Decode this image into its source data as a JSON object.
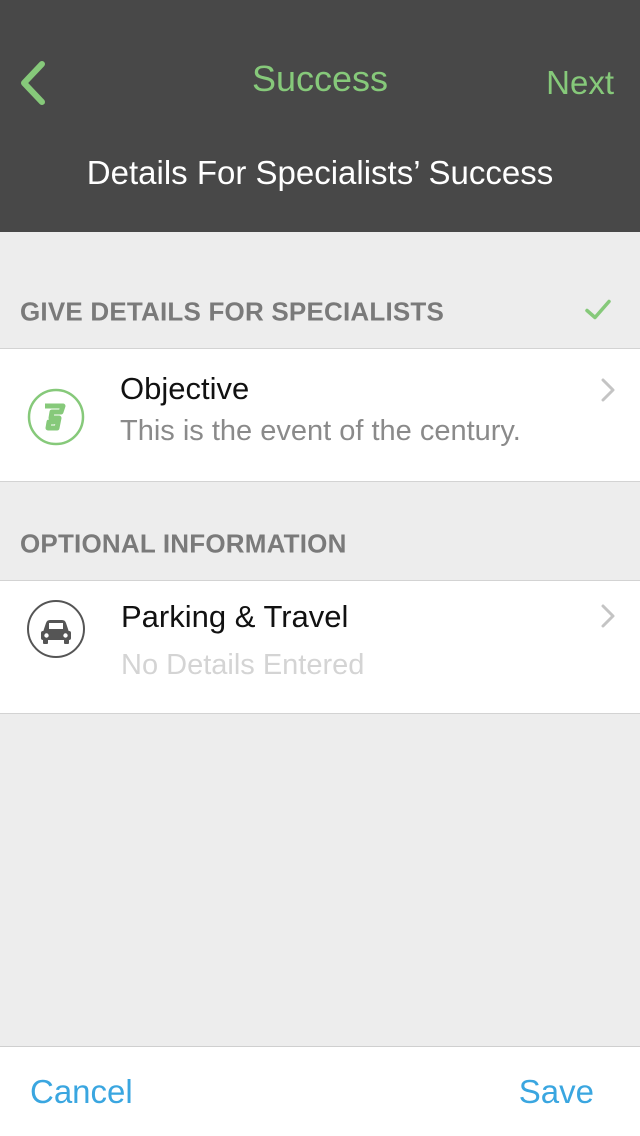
{
  "nav": {
    "title": "Success",
    "next_label": "Next",
    "subtitle": "Details For Specialists’ Success"
  },
  "sections": {
    "required": {
      "header": "GIVE DETAILS FOR SPECIALISTS",
      "objective": {
        "title": "Objective",
        "detail": "This is the event of the century.",
        "icon": "objective-logo-icon"
      }
    },
    "optional": {
      "header": "OPTIONAL INFORMATION",
      "parking": {
        "title": "Parking & Travel",
        "detail": "No Details Entered",
        "icon": "car-icon"
      }
    }
  },
  "toolbar": {
    "cancel_label": "Cancel",
    "save_label": "Save"
  },
  "colors": {
    "accent_green": "#86c97a",
    "action_blue": "#3aa6e0",
    "nav_background": "#484848"
  }
}
